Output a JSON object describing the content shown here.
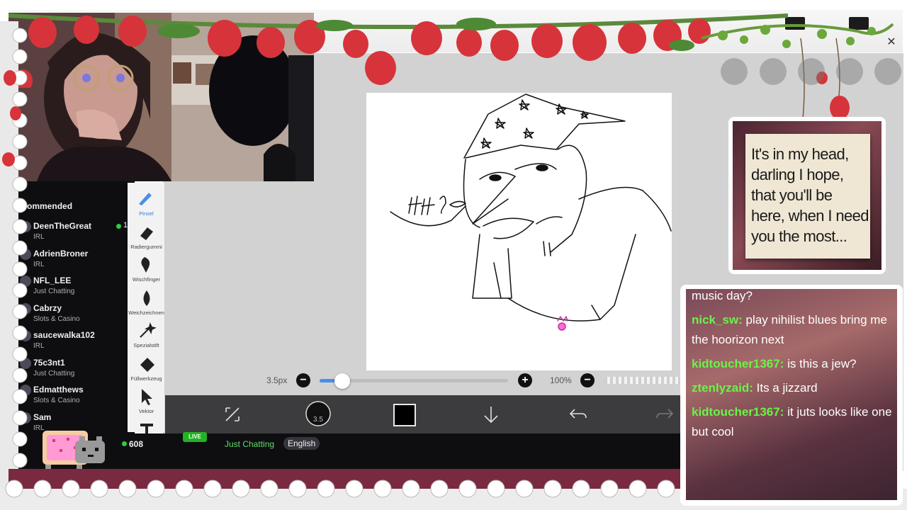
{
  "sidebar": {
    "heading": "Recommended",
    "channels": [
      {
        "name": "DeenTheGreat",
        "category": "IRL",
        "viewers": "1"
      },
      {
        "name": "AdrienBroner",
        "category": "IRL",
        "viewers": ""
      },
      {
        "name": "NFL_LEE",
        "category": "Just Chatting",
        "viewers": ""
      },
      {
        "name": "Cabrzy",
        "category": "Slots & Casino",
        "viewers": ""
      },
      {
        "name": "saucewalka102",
        "category": "IRL",
        "viewers": ""
      },
      {
        "name": "75c3nt1",
        "category": "Just Chatting",
        "viewers": ""
      },
      {
        "name": "Edmatthews",
        "category": "Slots & Casino",
        "viewers": ""
      },
      {
        "name": "Sam",
        "category": "IRL",
        "viewers": ""
      }
    ]
  },
  "tools": [
    {
      "label": "Pinsel",
      "icon": "brush-icon"
    },
    {
      "label": "Radiergummi",
      "icon": "eraser-icon"
    },
    {
      "label": "Wischfinger",
      "icon": "smudge-icon"
    },
    {
      "label": "Weichzeichnen",
      "icon": "blur-drop-icon"
    },
    {
      "label": "Spezialstift",
      "icon": "magic-pen-icon"
    },
    {
      "label": "Füllwerkzeug",
      "icon": "fill-icon"
    },
    {
      "label": "Vektor",
      "icon": "vector-arrow-icon"
    },
    {
      "label": "T",
      "icon": "text-icon"
    }
  ],
  "brush": {
    "size_label": "3.5px",
    "size_fraction": 0.12,
    "zoom_label": "100%",
    "bubble_size": "3.5"
  },
  "stream": {
    "live": "LIVE",
    "viewers": "608",
    "category": "Just Chatting",
    "language": "English"
  },
  "quote": {
    "text": "It's in my head, darling I hope, that you'll be here, when I need you the most..."
  },
  "chat": {
    "messages": [
      {
        "user": "",
        "text": "music day?"
      },
      {
        "user": "nick_sw:",
        "text": "play nihilist blues bring me the hoorizon next"
      },
      {
        "user": "kidtoucher1367:",
        "text": "is this a jew?"
      },
      {
        "user": "ztenlyzaid:",
        "text": "Its a jizzard"
      },
      {
        "user": "kidtoucher1367:",
        "text": "it juts looks like one but cool"
      }
    ]
  },
  "colors": {
    "accent_blue": "#4a8fe5",
    "twitch_green": "#5fdc6a",
    "chat_user": "#6cf24a",
    "sidebar_bg": "#0e0e10"
  }
}
